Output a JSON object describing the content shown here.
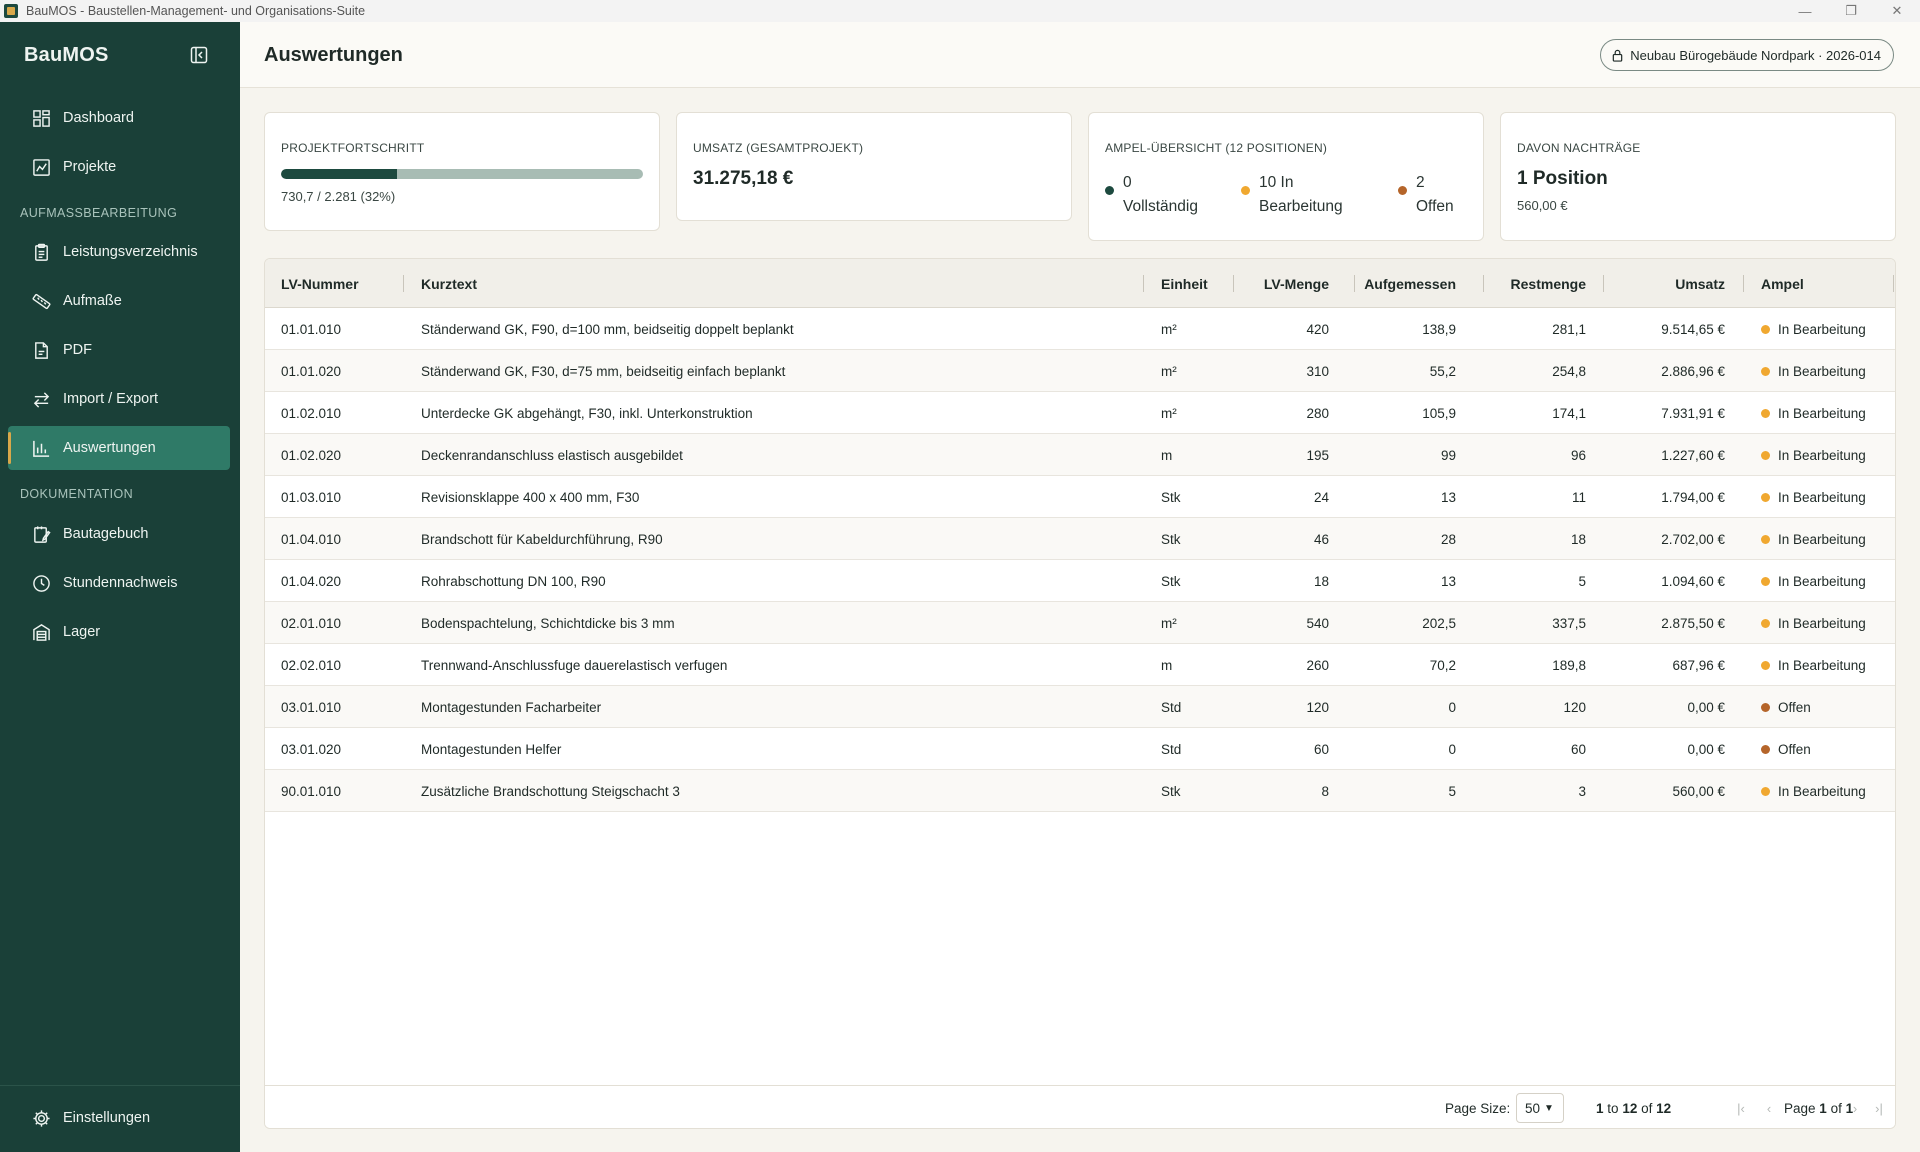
{
  "window": {
    "title": "BauMOS - Baustellen-Management- und Organisations-Suite"
  },
  "sidebar": {
    "brand": "BauMOS",
    "nav_main": [
      {
        "label": "Dashboard",
        "icon": "dashboard-icon"
      },
      {
        "label": "Projekte",
        "icon": "chart-projects-icon"
      }
    ],
    "section_aufmass": "AUFMASSBEARBEITUNG",
    "nav_aufmass": [
      {
        "label": "Leistungsverzeichnis",
        "icon": "clipboard-icon"
      },
      {
        "label": "Aufmaße",
        "icon": "ruler-icon"
      },
      {
        "label": "PDF",
        "icon": "file-pdf-icon"
      },
      {
        "label": "Import / Export",
        "icon": "arrows-exchange-icon"
      },
      {
        "label": "Auswertungen",
        "icon": "bar-chart-icon",
        "active": true
      }
    ],
    "section_doku": "DOKUMENTATION",
    "nav_doku": [
      {
        "label": "Bautagebuch",
        "icon": "notebook-icon"
      },
      {
        "label": "Stundennachweis",
        "icon": "clock-icon"
      },
      {
        "label": "Lager",
        "icon": "warehouse-icon"
      }
    ],
    "settings": {
      "label": "Einstellungen",
      "icon": "gear-icon"
    }
  },
  "header": {
    "title": "Auswertungen",
    "project": "Neubau Bürogebäude Nordpark · 2026-014"
  },
  "cards": {
    "progress": {
      "label": "PROJEKTFORTSCHRITT",
      "text": "730,7 / 2.281 (32%)",
      "fraction": 0.32
    },
    "umsatz": {
      "label": "UMSATZ (GESAMTPROJEKT)",
      "value": "31.275,18 €"
    },
    "ampel": {
      "label": "AMPEL-ÜBERSICHT (12 POSITIONEN)",
      "groups": [
        {
          "line1": "0",
          "line2": "Vollständig",
          "color": "#1d4a3f"
        },
        {
          "line1": "10 In",
          "line2": "Bearbeitung",
          "color": "#f0a830"
        },
        {
          "line1": "2",
          "line2": "Offen",
          "color": "#b5652a"
        }
      ]
    },
    "nachtraege": {
      "label": "DAVON NACHTRÄGE",
      "value": "1 Position",
      "sub": "560,00 €"
    }
  },
  "table": {
    "columns": [
      "LV-Nummer",
      "Kurztext",
      "Einheit",
      "LV-Menge",
      "Aufgemessen",
      "Restmenge",
      "Umsatz",
      "Ampel"
    ],
    "rows": [
      {
        "nr": "01.01.010",
        "text": "Ständerwand GK, F90, d=100 mm, beidseitig doppelt beplankt",
        "unit": "m²",
        "lv": "420",
        "auf": "138,9",
        "rest": "281,1",
        "umsatz": "9.514,65 €",
        "ampel": "In Bearbeitung",
        "color": "#f0a830"
      },
      {
        "nr": "01.01.020",
        "text": "Ständerwand GK, F30, d=75 mm, beidseitig einfach beplankt",
        "unit": "m²",
        "lv": "310",
        "auf": "55,2",
        "rest": "254,8",
        "umsatz": "2.886,96 €",
        "ampel": "In Bearbeitung",
        "color": "#f0a830"
      },
      {
        "nr": "01.02.010",
        "text": "Unterdecke GK abgehängt, F30, inkl. Unterkonstruktion",
        "unit": "m²",
        "lv": "280",
        "auf": "105,9",
        "rest": "174,1",
        "umsatz": "7.931,91 €",
        "ampel": "In Bearbeitung",
        "color": "#f0a830"
      },
      {
        "nr": "01.02.020",
        "text": "Deckenrandanschluss elastisch ausgebildet",
        "unit": "m",
        "lv": "195",
        "auf": "99",
        "rest": "96",
        "umsatz": "1.227,60 €",
        "ampel": "In Bearbeitung",
        "color": "#f0a830"
      },
      {
        "nr": "01.03.010",
        "text": "Revisionsklappe 400 x 400 mm, F30",
        "unit": "Stk",
        "lv": "24",
        "auf": "13",
        "rest": "11",
        "umsatz": "1.794,00 €",
        "ampel": "In Bearbeitung",
        "color": "#f0a830"
      },
      {
        "nr": "01.04.010",
        "text": "Brandschott für Kabeldurchführung, R90",
        "unit": "Stk",
        "lv": "46",
        "auf": "28",
        "rest": "18",
        "umsatz": "2.702,00 €",
        "ampel": "In Bearbeitung",
        "color": "#f0a830"
      },
      {
        "nr": "01.04.020",
        "text": "Rohrabschottung DN 100, R90",
        "unit": "Stk",
        "lv": "18",
        "auf": "13",
        "rest": "5",
        "umsatz": "1.094,60 €",
        "ampel": "In Bearbeitung",
        "color": "#f0a830"
      },
      {
        "nr": "02.01.010",
        "text": "Bodenspachtelung, Schichtdicke bis 3 mm",
        "unit": "m²",
        "lv": "540",
        "auf": "202,5",
        "rest": "337,5",
        "umsatz": "2.875,50 €",
        "ampel": "In Bearbeitung",
        "color": "#f0a830"
      },
      {
        "nr": "02.02.010",
        "text": "Trennwand-Anschlussfuge dauerelastisch verfugen",
        "unit": "m",
        "lv": "260",
        "auf": "70,2",
        "rest": "189,8",
        "umsatz": "687,96 €",
        "ampel": "In Bearbeitung",
        "color": "#f0a830"
      },
      {
        "nr": "03.01.010",
        "text": "Montagestunden Facharbeiter",
        "unit": "Std",
        "lv": "120",
        "auf": "0",
        "rest": "120",
        "umsatz": "0,00 €",
        "ampel": "Offen",
        "color": "#b5652a"
      },
      {
        "nr": "03.01.020",
        "text": "Montagestunden Helfer",
        "unit": "Std",
        "lv": "60",
        "auf": "0",
        "rest": "60",
        "umsatz": "0,00 €",
        "ampel": "Offen",
        "color": "#b5652a"
      },
      {
        "nr": "90.01.010",
        "text": "Zusätzliche Brandschottung Steigschacht 3",
        "unit": "Stk",
        "lv": "8",
        "auf": "5",
        "rest": "3",
        "umsatz": "560,00 €",
        "ampel": "In Bearbeitung",
        "color": "#f0a830"
      }
    ]
  },
  "pagination": {
    "page_size_label": "Page Size:",
    "page_size": "50",
    "range_from": "1",
    "range_to_word": "to",
    "range_to": "12",
    "range_of_word": "of",
    "range_total": "12",
    "page_word": "Page",
    "page": "1",
    "of_word": "of",
    "pages": "1"
  }
}
